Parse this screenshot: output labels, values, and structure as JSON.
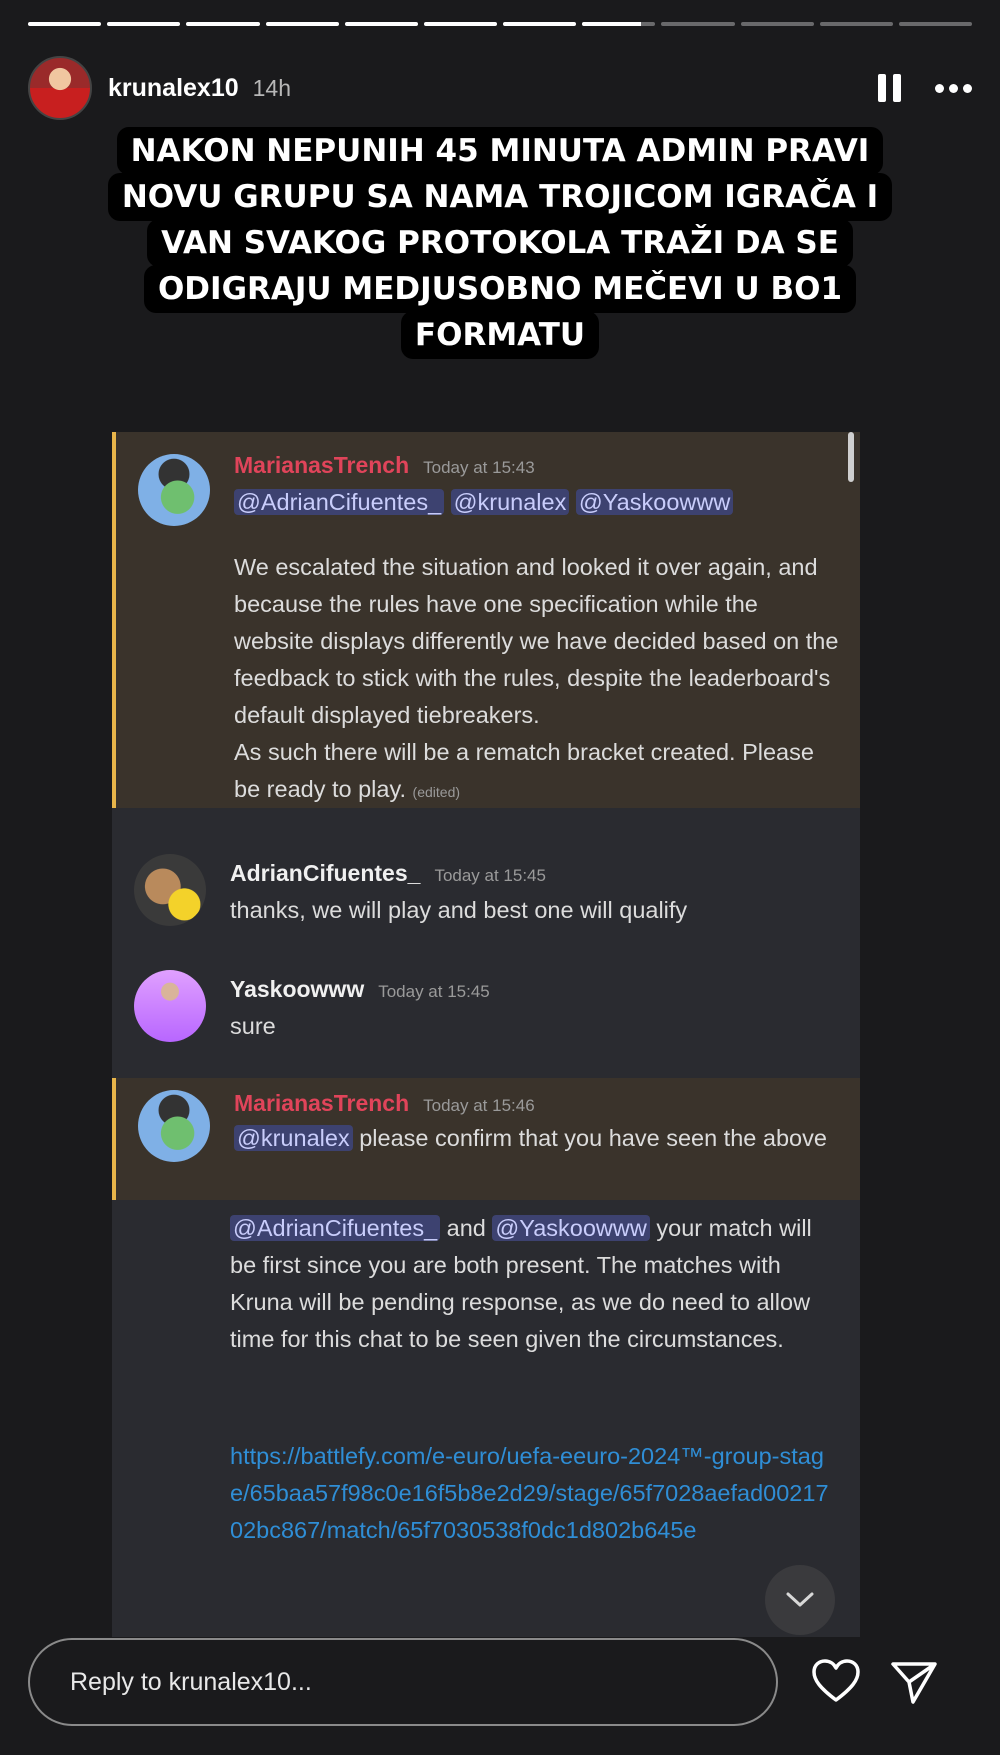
{
  "story": {
    "progress_segments": 12,
    "progress_completed": 7,
    "progress_current_fraction": 0.8
  },
  "header": {
    "username": "krunalex10",
    "time": "14h",
    "icons": [
      "pause-icon",
      "more-icon"
    ]
  },
  "caption": {
    "lines": [
      "NAKON NEPUNIH 45 MINUTA ADMIN PRAVI",
      "NOVU GRUPU SA NAMA TROJICOM IGRAČA I",
      "VAN SVAKOG PROTOKOLA TRAŽI DA SE",
      "ODIGRAJU MEDJUSOBNO MEČEVI U BO1",
      "FORMATU"
    ]
  },
  "discord": {
    "msg1": {
      "author": "MarianasTrench",
      "timestamp": "Today at 15:43",
      "mentions": [
        "@AdrianCifuentes_",
        "@krunalex",
        "@Yaskoowww"
      ],
      "para1": "We escalated the situation and looked it over again, and because the rules have one specification while the website displays differently we have decided based on the feedback to stick with the rules, despite the leaderboard's default displayed tiebreakers.",
      "para2": "As such there will be a rematch bracket created. Please be ready to play.",
      "edited": "(edited)"
    },
    "msg2": {
      "author": "AdrianCifuentes_",
      "timestamp": "Today at 15:45",
      "text": "thanks, we will play and best one will qualify"
    },
    "msg3": {
      "author": "Yaskoowww",
      "timestamp": "Today at 15:45",
      "text": "sure"
    },
    "msg4": {
      "author": "MarianasTrench",
      "timestamp": "Today at 15:46",
      "mention": "@krunalex",
      "text": "please confirm that you have seen the above",
      "mention_a": "@AdrianCifuentes_",
      "and": "and",
      "mention_b": "@Yaskoowww",
      "text2": "your match will be first since you are both present. The matches with Kruna will be pending response, as we do need to allow time for this chat to be seen given the circumstances.",
      "link": "https://battlefy.com/e-euro/uefa-eeuro-2024™-group-stage/65baa57f98c0e16f5b8e2d29/stage/65f7028aefad0021702bc867/match/65f7030538f0dc1d802b645e"
    }
  },
  "reply": {
    "placeholder": "Reply to krunalex10..."
  },
  "colors": {
    "mention_bg": "#3d4270",
    "highlight_bar": "#e8b54a",
    "author_red": "#e0445a",
    "link": "#2f8ed6"
  }
}
